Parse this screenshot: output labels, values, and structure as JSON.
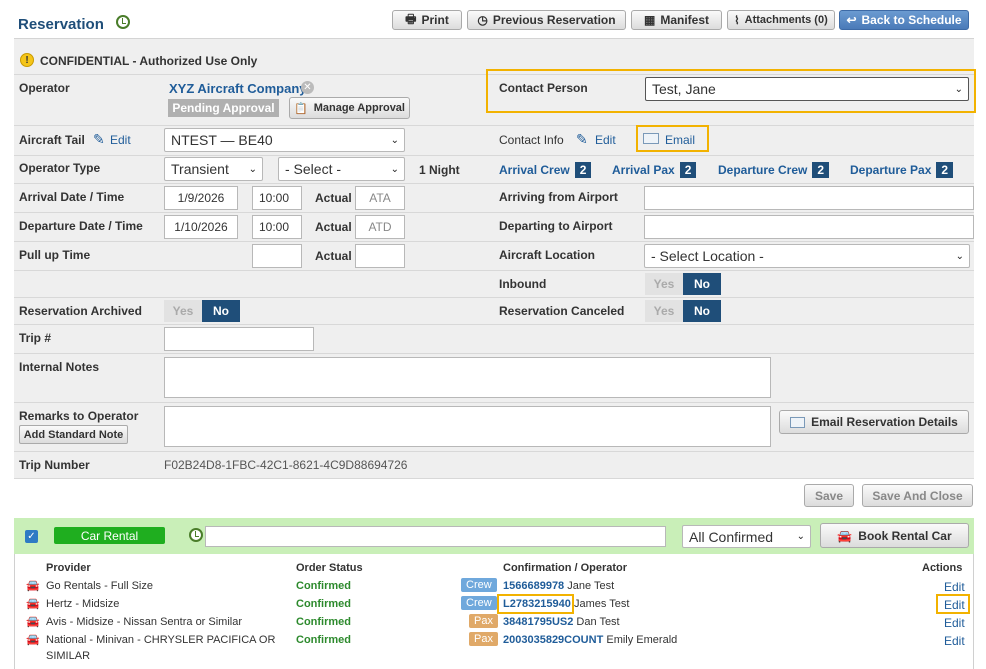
{
  "header": {
    "title": "Reservation",
    "print": "Print",
    "previous": "Previous Reservation",
    "manifest": "Manifest",
    "attachments": "Attachments (0)",
    "back": "Back to Schedule"
  },
  "confidential": "CONFIDENTIAL - Authorized Use Only",
  "operator": {
    "label": "Operator",
    "value": "XYZ Aircraft Company",
    "status": "Pending Approval",
    "manage": "Manage Approval"
  },
  "contact_person": {
    "label": "Contact Person",
    "value": "Test, Jane"
  },
  "aircraft_tail": {
    "label": "Aircraft Tail",
    "edit": "Edit",
    "value": "NTEST — BE40"
  },
  "contact_info": {
    "label": "Contact Info",
    "edit": "Edit",
    "email": "Email"
  },
  "operator_type": {
    "label": "Operator Type",
    "value": "Transient",
    "select": "- Select -",
    "nights": "1 Night"
  },
  "crew_counts": {
    "arrival_crew": "Arrival Crew",
    "arrival_crew_n": "2",
    "arrival_pax": "Arrival Pax",
    "arrival_pax_n": "2",
    "departure_crew": "Departure Crew",
    "departure_crew_n": "2",
    "departure_pax": "Departure Pax",
    "departure_pax_n": "2"
  },
  "arrival": {
    "label": "Arrival Date / Time",
    "date": "1/9/2026",
    "time": "10:00",
    "actual": "Actual",
    "actual_placeholder": "ATA"
  },
  "departure": {
    "label": "Departure Date / Time",
    "date": "1/10/2026",
    "time": "10:00",
    "actual": "Actual",
    "actual_placeholder": "ATD"
  },
  "pullup": {
    "label": "Pull up Time",
    "actual": "Actual"
  },
  "arriving_from": {
    "label": "Arriving from Airport"
  },
  "departing_to": {
    "label": "Departing to Airport"
  },
  "aircraft_location": {
    "label": "Aircraft Location",
    "value": "- Select Location -"
  },
  "inbound": {
    "label": "Inbound",
    "yes": "Yes",
    "no": "No"
  },
  "archived": {
    "label": "Reservation Archived",
    "yes": "Yes",
    "no": "No"
  },
  "canceled": {
    "label": "Reservation Canceled",
    "yes": "Yes",
    "no": "No"
  },
  "trip": {
    "label": "Trip #"
  },
  "internal_notes": {
    "label": "Internal Notes"
  },
  "remarks": {
    "label": "Remarks to Operator",
    "add_note": "Add Standard Note",
    "email_details": "Email Reservation Details"
  },
  "trip_number": {
    "label": "Trip Number",
    "value": "F02B24D8-1FBC-42C1-8621-4C9D88694726"
  },
  "actions": {
    "save": "Save",
    "save_close": "Save And Close"
  },
  "car_rental": {
    "title": "Car Rental",
    "filter": "All Confirmed",
    "book": "Book Rental Car",
    "headers": {
      "provider": "Provider",
      "status": "Order Status",
      "confirmation": "Confirmation / Operator",
      "actions": "Actions"
    },
    "rows": [
      {
        "provider": "Go Rentals - Full Size",
        "status": "Confirmed",
        "tag": "Crew",
        "conf": "1566689978",
        "person": "Jane Test",
        "action": "Edit"
      },
      {
        "provider": "Hertz - Midsize",
        "status": "Confirmed",
        "tag": "Crew",
        "conf": "L2783215940",
        "person": "James Test",
        "action": "Edit"
      },
      {
        "provider": "Avis - Midsize - Nissan Sentra or Similar",
        "status": "Confirmed",
        "tag": "Pax",
        "conf": "38481795US2",
        "person": "Dan Test",
        "action": "Edit"
      },
      {
        "provider": "National - Minivan - CHRYSLER PACIFICA OR",
        "provider2": "SIMILAR",
        "status": "Confirmed",
        "tag": "Pax",
        "conf": "2003035829COUNT",
        "person": "Emily Emerald",
        "action": "Edit"
      }
    ]
  }
}
